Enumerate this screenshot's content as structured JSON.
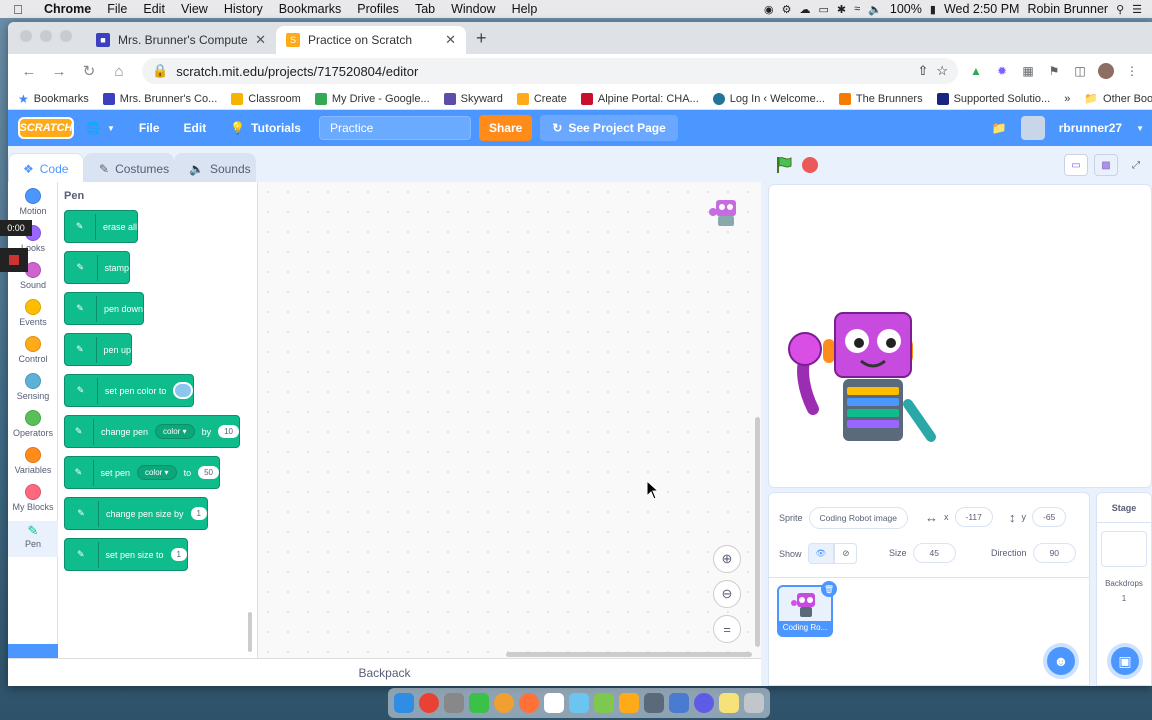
{
  "menubar": {
    "app": "Chrome",
    "items": [
      "File",
      "Edit",
      "View",
      "History",
      "Bookmarks",
      "Profiles",
      "Tab",
      "Window",
      "Help"
    ],
    "battery": "100%",
    "clock": "Wed 2:50 PM",
    "user": "Robin Brunner"
  },
  "browser": {
    "tabs": [
      {
        "title": "Mrs. Brunner's Computer Lab",
        "active": false,
        "color": "#3b3fc0"
      },
      {
        "title": "Practice on Scratch",
        "active": true,
        "color": "#ffab19"
      }
    ],
    "url": "scratch.mit.edu/projects/717520804/editor",
    "bookmarks": [
      {
        "label": "Bookmarks",
        "color": "#f4c20d"
      },
      {
        "label": "Mrs. Brunner's Co...",
        "color": "#3b3fc0"
      },
      {
        "label": "Classroom",
        "color": "#f4b400"
      },
      {
        "label": "My Drive - Google...",
        "color": "#34a853"
      },
      {
        "label": "Skyward",
        "color": "#5b4ea8"
      },
      {
        "label": "Create",
        "color": "#ffab19"
      },
      {
        "label": "Alpine Portal: CHA...",
        "color": "#c8102e"
      },
      {
        "label": "Log In ‹ Welcome...",
        "color": "#21759b"
      },
      {
        "label": "The Brunners",
        "color": "#f57c00"
      },
      {
        "label": "Supported Solutio...",
        "color": "#1a237e"
      }
    ],
    "bookmarks_more": "»",
    "other_bookmarks": "Other Bookmarks"
  },
  "scratch": {
    "logo": "SCRATCH",
    "menu": {
      "file": "File",
      "edit": "Edit",
      "tutorials": "Tutorials"
    },
    "project_title": "Practice",
    "share": "Share",
    "see_project_page": "See Project Page",
    "username": "rbrunner27",
    "editor_tabs": {
      "code": "Code",
      "costumes": "Costumes",
      "sounds": "Sounds"
    },
    "categories": [
      {
        "label": "Motion",
        "color": "#4c97ff"
      },
      {
        "label": "Looks",
        "color": "#9966ff"
      },
      {
        "label": "Sound",
        "color": "#cf63cf"
      },
      {
        "label": "Events",
        "color": "#ffbf00"
      },
      {
        "label": "Control",
        "color": "#ffab19"
      },
      {
        "label": "Sensing",
        "color": "#5cb1d6"
      },
      {
        "label": "Operators",
        "color": "#59c059"
      },
      {
        "label": "Variables",
        "color": "#ff8c1a"
      },
      {
        "label": "My Blocks",
        "color": "#ff6680"
      },
      {
        "label": "Pen",
        "color": "#0fbd8c"
      }
    ],
    "palette_heading": "Pen",
    "blocks": {
      "erase_all": "erase all",
      "stamp": "stamp",
      "pen_down": "pen down",
      "pen_up": "pen up",
      "set_color": "set pen color to",
      "change_pen": "change pen",
      "change_pen_dropdown": "color",
      "change_pen_by": "by",
      "change_pen_value": "10",
      "set_pen": "set pen",
      "set_pen_dropdown": "color",
      "set_pen_to": "to",
      "set_pen_value": "50",
      "change_size": "change pen size by",
      "change_size_value": "1",
      "set_size": "set pen size to",
      "set_size_value": "1"
    },
    "backpack": "Backpack",
    "sprite_info": {
      "sprite_label": "Sprite",
      "sprite_name": "Coding Robot image",
      "x_label": "x",
      "x": "-117",
      "y_label": "y",
      "y": "-65",
      "show_label": "Show",
      "size_label": "Size",
      "size": "45",
      "direction_label": "Direction",
      "direction": "90"
    },
    "sprite_tile_label": "Coding Ro...",
    "stage_panel": {
      "title": "Stage",
      "backdrops_label": "Backdrops",
      "backdrops_count": "1"
    }
  },
  "recorder": {
    "time": "0:00"
  }
}
